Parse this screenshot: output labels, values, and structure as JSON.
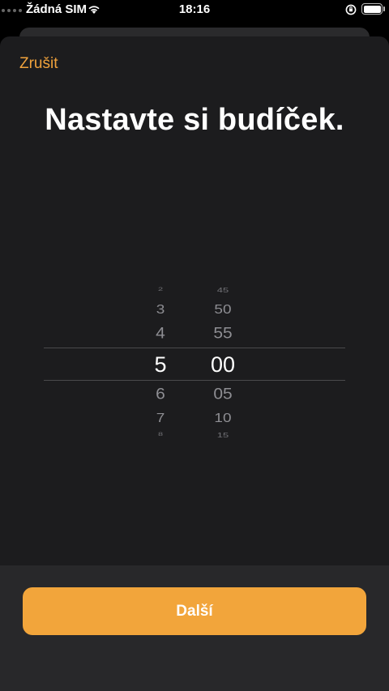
{
  "status_bar": {
    "carrier": "Žádná SIM",
    "time": "18:16",
    "icons": [
      "signal-dots-icon",
      "wifi-icon",
      "orientation-lock-icon",
      "battery-icon"
    ]
  },
  "sheet": {
    "cancel_label": "Zrušit",
    "title": "Nastavte si budíček."
  },
  "picker": {
    "hours": {
      "selected": "5",
      "above": [
        "2",
        "3",
        "4"
      ],
      "below": [
        "6",
        "7",
        "8"
      ]
    },
    "minutes": {
      "selected": "00",
      "above": [
        "45",
        "50",
        "55"
      ],
      "below": [
        "05",
        "10",
        "15"
      ]
    }
  },
  "footer": {
    "next_label": "Další"
  },
  "colors": {
    "accent": "#f2a53b",
    "sheet_background": "#1c1c1e",
    "footer_background": "#28282a"
  }
}
